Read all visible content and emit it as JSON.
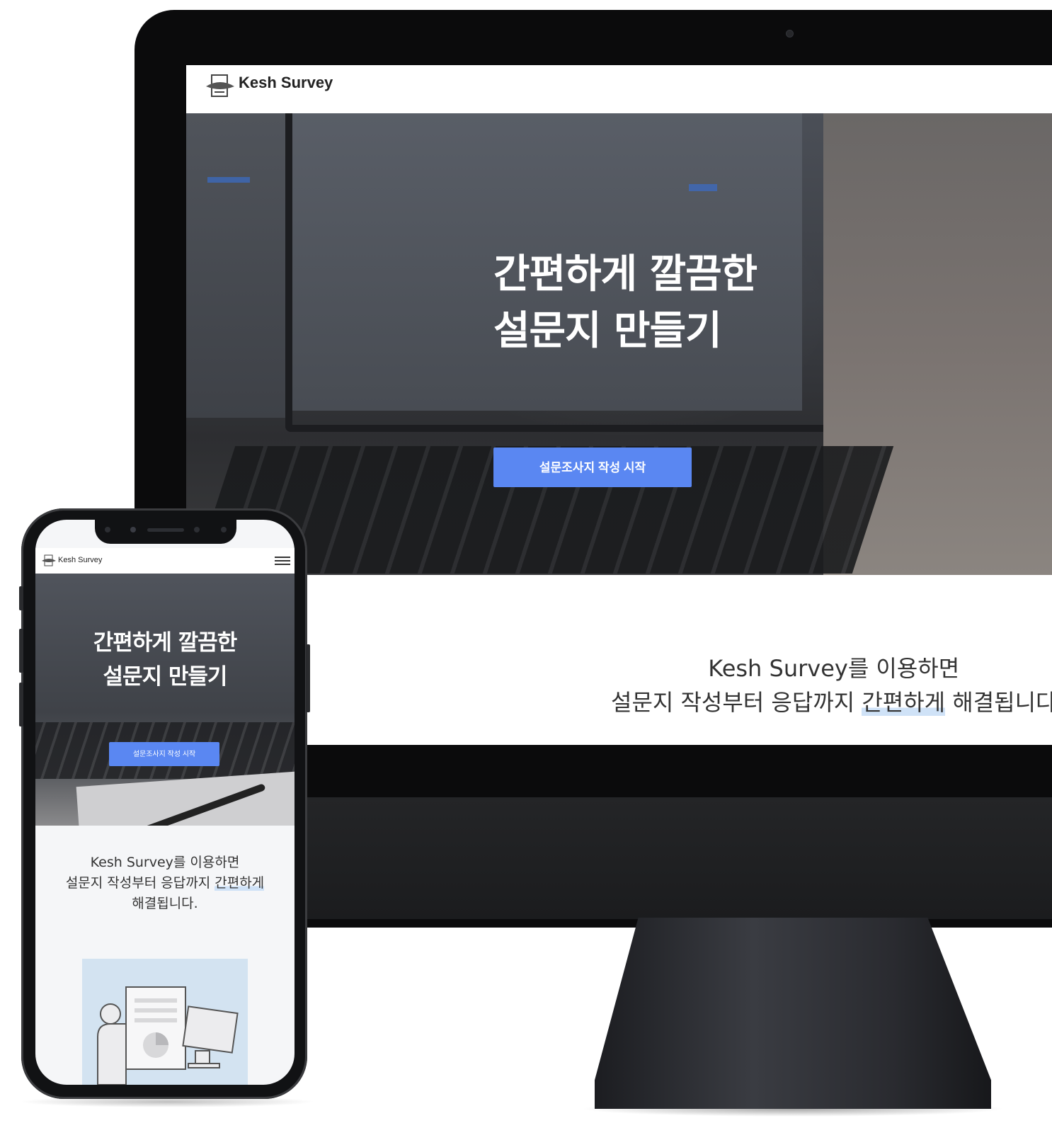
{
  "desktop": {
    "brand": "Kesh Survey",
    "hero": {
      "title_line1": "간편하게 깔끔한",
      "title_line2": "설문지 만들기",
      "cta": "설문조사지 작성 시작"
    },
    "intro": {
      "line1": "Kesh Survey를 이용하면",
      "line2_pre": "설문지 작성부터 응답까지 ",
      "line2_highlight": "간편하게",
      "line2_post": " 해결됩니다"
    }
  },
  "mobile": {
    "brand": "Kesh Survey",
    "menu_icon": "hamburger-icon",
    "hero": {
      "title_line1": "간편하게 깔끔한",
      "title_line2": "설문지 만들기",
      "cta": "설문조사지 작성 시작"
    },
    "intro": {
      "line1": "Kesh Survey를 이용하면",
      "line2_pre": "설문지 작성부터 응답까지 ",
      "line2_highlight": "간편하게",
      "line3": "해결됩니다."
    },
    "illustration": "survey-illustration"
  },
  "colors": {
    "accent": "#5a87f2",
    "highlight": "#cfe2f7",
    "illustration_bg": "#d3e3f1"
  }
}
